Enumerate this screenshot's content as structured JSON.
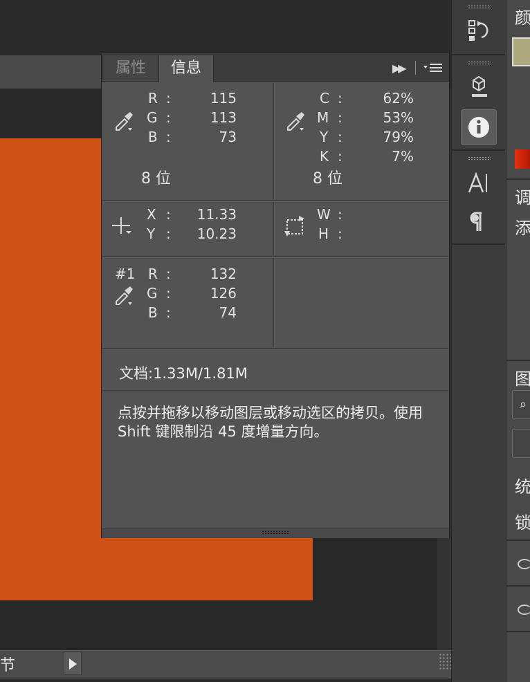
{
  "status_bar": {
    "text": "节"
  },
  "right_dock": {
    "chars": [
      "颜",
      "调",
      "添",
      "图",
      "统",
      "锁"
    ],
    "swatch_color": "#ada97c"
  },
  "info_panel": {
    "tabs": [
      {
        "label": "属性",
        "active": false
      },
      {
        "label": "信息",
        "active": true
      }
    ],
    "rgb": [
      {
        "label": "R",
        "value": "115"
      },
      {
        "label": "G",
        "value": "113"
      },
      {
        "label": "B",
        "value": "73"
      }
    ],
    "rgb_bits": "8 位",
    "cmyk": [
      {
        "label": "C",
        "value": "62%"
      },
      {
        "label": "M",
        "value": "53%"
      },
      {
        "label": "Y",
        "value": "79%"
      },
      {
        "label": "K",
        "value": "7%"
      }
    ],
    "cmyk_bits": "8 位",
    "position": [
      {
        "label": "X",
        "value": "11.33"
      },
      {
        "label": "Y",
        "value": "10.23"
      }
    ],
    "size": [
      {
        "label": "W"
      },
      {
        "label": "H"
      }
    ],
    "sampler": {
      "id": "#1",
      "values": [
        {
          "label": "R",
          "value": "132"
        },
        {
          "label": "G",
          "value": "126"
        },
        {
          "label": "B",
          "value": "74"
        }
      ]
    },
    "colon": ":",
    "doc_size": "文档:1.33M/1.81M",
    "hint": "点按并拖移以移动图层或移动选区的拷贝。使用 Shift 键限制沿 45 度增量方向。"
  },
  "colors": {
    "canvas_orange": "#cf5116",
    "panel_bg": "#535353"
  }
}
